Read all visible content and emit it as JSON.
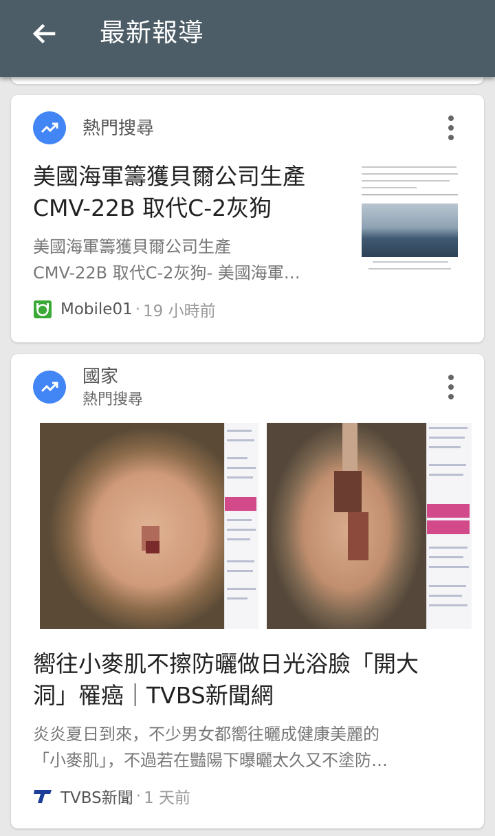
{
  "appbar": {
    "title": "最新報導",
    "back_icon": "arrow-back-icon"
  },
  "cards": [
    {
      "topic": "熱門搜尋",
      "headline_lines": [
        "美國海軍籌獲貝爾公司生產",
        "CMV-22B 取代C-2灰狗"
      ],
      "snippet_lines": [
        "美國海軍籌獲貝爾公司生產",
        "CMV-22B 取代C-2灰狗- 美國海軍…"
      ],
      "source": "Mobile01",
      "time": "19 小時前",
      "source_icon": "mobile01-logo-icon"
    },
    {
      "topic": "國家",
      "subtopic": "熱門搜尋",
      "headline_lines": [
        "嚮往小麥肌不擦防曬做日光浴臉「開大",
        "洞」罹癌｜TVBS新聞網"
      ],
      "snippet_lines": [
        "炎炎夏日到來，不少男女都嚮往曬成健康美麗的",
        "「小麥肌」，不過若在豔陽下曝曬太久又不塗防…"
      ],
      "source": "TVBS新聞",
      "time": "1 天前",
      "source_icon": "tvbs-logo-icon"
    }
  ],
  "colors": {
    "appbar": "#4c5d67",
    "trend_icon_bg": "#4285f4",
    "mobile01_green": "#3aa935",
    "tvbs_blue": "#1d3f9a"
  }
}
